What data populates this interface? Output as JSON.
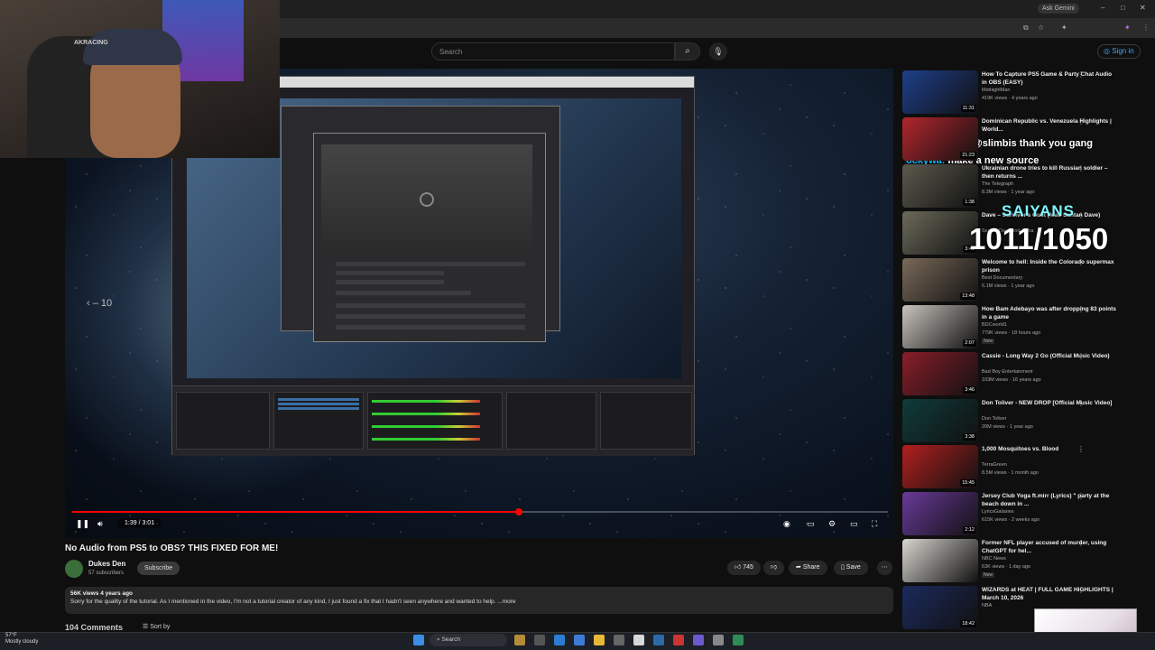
{
  "browser": {
    "ask_gemini": "Ask Gemini",
    "window_controls": [
      "–",
      "□",
      "✕"
    ]
  },
  "youtube_header": {
    "search_placeholder": "Search",
    "sign_in": "Sign in"
  },
  "overlay": {
    "chat_line_1_name": "@slimbis",
    "chat_line_1_text": "thank you gang",
    "chat_line_2_name": "ockywa:",
    "chat_line_2_text": "make a new source",
    "goal_label": "SAIYANS",
    "goal_counter": "1011/1050",
    "webcam_brand": "AKRACING"
  },
  "player": {
    "seek_hint": "‹ – 10",
    "time": "1:39 / 3:01",
    "progress_fraction": 0.548,
    "accent_color": "#ff0000"
  },
  "video": {
    "title": "No Audio from PS5 to OBS? THIS FIXED FOR ME!",
    "channel": "Dukes Den",
    "subscribers": "57 subscribers",
    "subscribe_label": "Subscribe",
    "likes": "745",
    "share_label": "Share",
    "save_label": "Save",
    "desc_meta": "56K views  4 years ago",
    "desc_text": "Sorry for the quality of the tutorial. As I mentioned in the video, I'm not a tutorial creator of any kind, I just found a fix that I hadn't seen anywhere and wanted to help. ...more",
    "comments_label": "104 Comments",
    "sort_label": "Sort by"
  },
  "recommendations": [
    {
      "title": "How To Capture PS5 Game & Party Chat Audio in OBS (EASY)",
      "channel": "MidnightMan",
      "meta": "419K views · 4 years ago",
      "duration": "11:31",
      "badge": "",
      "color": "#1d3f8a"
    },
    {
      "title": "Dominican Republic vs. Venezuela Highlights | World...",
      "channel": "",
      "meta": "",
      "duration": "21:23",
      "badge": "",
      "color": "#b3262d"
    },
    {
      "title": "Ukrainian drone tries to kill Russian soldier – then returns ...",
      "channel": "The Telegraph",
      "meta": "8.3M views · 1 year ago",
      "duration": "1:38",
      "badge": "",
      "color": "#5c5a4d"
    },
    {
      "title": "Dave – Survivor's Guilt (feat. Santan Dave)",
      "channel": "Santan Dave and Tiana",
      "meta": "",
      "duration": "3:41",
      "badge": "",
      "color": "#6b6a5a"
    },
    {
      "title": "Welcome to hell: Inside the Colorado supermax prison",
      "channel": "Best Documentary",
      "meta": "6.1M views · 1 year ago",
      "duration": "13:48",
      "badge": "",
      "color": "#7a6a5a"
    },
    {
      "title": "How Bam Adebayo was after dropping 83 points in a game",
      "channel": "BDCworld1",
      "meta": "779K views · 18 hours ago",
      "duration": "2:07",
      "badge": "New",
      "color": "#c8c3bd"
    },
    {
      "title": "Cassie - Long Way 2 Go (Official Music Video)",
      "channel": "Bad Boy Entertainment",
      "meta": "103M views · 16 years ago",
      "duration": "3:46",
      "badge": "",
      "color": "#8a1e2a"
    },
    {
      "title": "Don Toliver - NEW DROP [Official Music Video]",
      "channel": "Don Toliver",
      "meta": "20M views · 1 year ago",
      "duration": "3:38",
      "badge": "",
      "color": "#0f3b3a"
    },
    {
      "title": "1,000 Mosquitoes vs. Blood",
      "channel": "TerraGreen",
      "meta": "8.5M views · 1 month ago",
      "duration": "15:45",
      "badge": "",
      "color": "#b1201f"
    },
    {
      "title": "Jersey Club Yoga ft.mirr (Lyrics) \" party at the beach down in ...",
      "channel": "LyricsGalaxies",
      "meta": "615K views · 2 weeks ago",
      "duration": "2:12",
      "badge": "",
      "color": "#6a3a9a"
    },
    {
      "title": "Former NFL player accused of murder, using ChatGPT for hel...",
      "channel": "NBC News",
      "meta": "63K views · 1 day ago",
      "duration": "",
      "badge": "New",
      "color": "#d9d6d0"
    },
    {
      "title": "WIZARDS at HEAT | FULL GAME HIGHLIGHTS | March 10, 2026",
      "channel": "NBA",
      "meta": "",
      "duration": "18:42",
      "badge": "",
      "color": "#1b2a5c"
    }
  ],
  "taskbar": {
    "weather_temp": "57°F",
    "weather_desc": "Mostly cloudy",
    "search_label": "Search"
  }
}
